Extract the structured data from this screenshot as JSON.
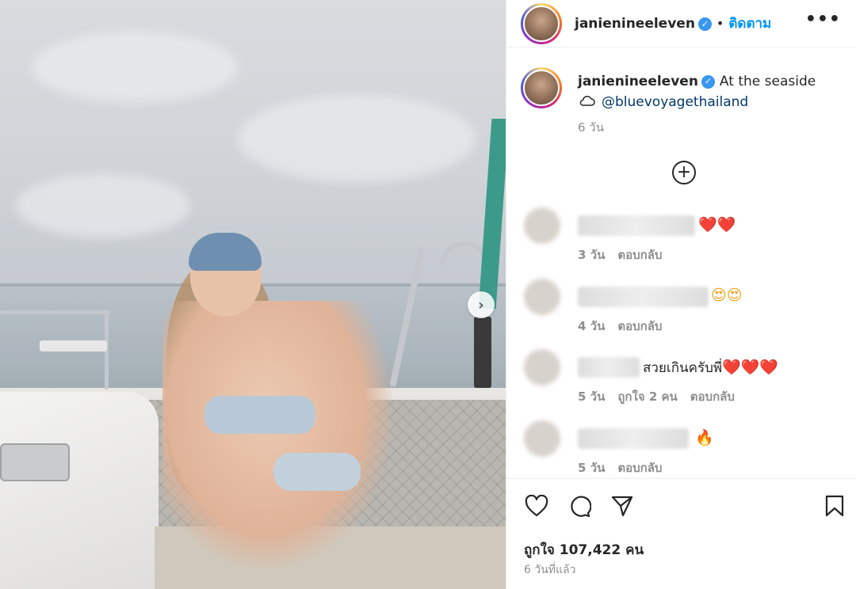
{
  "post": {
    "username": "janienineeleven",
    "follow_label": "ติดตาม",
    "more_label": "•••",
    "caption": "At the seaside",
    "mention": "@bluevoyagethailand",
    "caption_time": "6 วัน"
  },
  "comments": [
    {
      "emoji": "❤️❤️",
      "time": "3 วัน",
      "likes": "",
      "reply": "ตอบกลับ"
    },
    {
      "emoji": "😍😍",
      "time": "4 วัน",
      "likes": "",
      "reply": "ตอบกลับ"
    },
    {
      "text": "สวยเกินครับพี่",
      "emoji": "❤️❤️❤️",
      "time": "5 วัน",
      "likes": "ถูกใจ 2 คน",
      "reply": "ตอบกลับ"
    },
    {
      "emoji": "🔥",
      "time": "5 วัน",
      "likes": "",
      "reply": "ตอบกลับ"
    }
  ],
  "footer": {
    "likes_text": "ถูกใจ 107,422 คน",
    "posted_ago": "6 วันที่แล้ว"
  },
  "colors": {
    "accent_blue": "#0095f6",
    "mention_blue": "#00376b",
    "heart_red": "#e0245e"
  }
}
